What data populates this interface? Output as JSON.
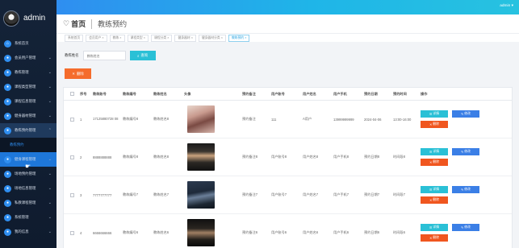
{
  "topbar": {
    "user": "admin ▾"
  },
  "brand": {
    "name": "admin"
  },
  "sidebar": {
    "items": [
      {
        "label": "系统首页",
        "icon": "home-icon",
        "chev": ""
      },
      {
        "label": "会员用户管理",
        "icon": "user-icon",
        "chev": "⌄"
      },
      {
        "label": "教练管理",
        "icon": "coach-icon",
        "chev": "⌄"
      },
      {
        "label": "课程类型管理",
        "icon": "list-icon",
        "chev": "⌄"
      },
      {
        "label": "课程信息管理",
        "icon": "book-icon",
        "chev": "⌄"
      },
      {
        "label": "健身器材管理",
        "icon": "dumbbell-icon",
        "chev": "⌄"
      },
      {
        "label": "教练预约管理",
        "icon": "calendar-icon",
        "chev": "⌃"
      }
    ],
    "submenu": "教练预约",
    "items2": [
      {
        "label": "健身课程管理",
        "icon": "class-icon",
        "chev": "⌄"
      },
      {
        "label": "场地预约管理",
        "icon": "venue-icon",
        "chev": "⌄"
      },
      {
        "label": "场地信息管理",
        "icon": "place-icon",
        "chev": "⌄"
      },
      {
        "label": "私教课程管理",
        "icon": "private-icon",
        "chev": "⌄"
      },
      {
        "label": "系统管理",
        "icon": "gear-icon",
        "chev": "⌄"
      },
      {
        "label": "我的信息",
        "icon": "info-icon",
        "chev": "⌄"
      }
    ]
  },
  "header": {
    "home": "首页",
    "title": "教练预约"
  },
  "tags": [
    "系统首页",
    "会员用户 ×",
    "教练 ×",
    "课程类型 ×",
    "课程分类 ×",
    "健身器材 ×",
    "健身器材分类 ×",
    "教练预约 ×"
  ],
  "search": {
    "label": "教练姓名",
    "placeholder": "教练姓名",
    "button": "查询"
  },
  "actions": {
    "delete": "删除"
  },
  "table": {
    "headers": [
      "序号",
      "教练账号",
      "教练编号",
      "教练姓名",
      "头像",
      "预约备注",
      "用户账号",
      "用户姓名",
      "用户手机",
      "预约日期",
      "预约时间",
      "操作"
    ],
    "rows": [
      {
        "idx": "1",
        "acct": "17125880728 08",
        "no": "教练编号8",
        "name": "教练姓名8",
        "note": "预约备注",
        "uacct": "111",
        "uname": "A用户",
        "phone": "13999999999",
        "date": "2024-04-06",
        "time": "13:00-16:00"
      },
      {
        "idx": "2",
        "acct": "8888888888",
        "no": "教练编号8",
        "name": "教练姓名8",
        "note": "预约备注8",
        "uacct": "用户账号8",
        "uname": "用户姓名8",
        "phone": "用户手机8",
        "date": "预约日期8",
        "time": "时间段8"
      },
      {
        "idx": "3",
        "acct": "7777777777",
        "no": "教练编号7",
        "name": "教练姓名7",
        "note": "预约备注7",
        "uacct": "用户账号7",
        "uname": "用户姓名7",
        "phone": "用户手机7",
        "date": "预约日期7",
        "time": "时间段7"
      },
      {
        "idx": "4",
        "acct": "6666666666",
        "no": "教练编号6",
        "name": "教练姓名6",
        "note": "预约备注6",
        "uacct": "用户账号6",
        "uname": "用户姓名6",
        "phone": "用户手机6",
        "date": "预约日期6",
        "time": "时间段6"
      }
    ],
    "buttons": {
      "detail": "详情",
      "edit": "修改",
      "delete": "删除"
    }
  },
  "colors": {
    "accent": "#2f8ef0",
    "detail": "#2ac0d6",
    "edit": "#3b7fe6",
    "delete": "#f0561f",
    "sidebar": "#142338"
  }
}
